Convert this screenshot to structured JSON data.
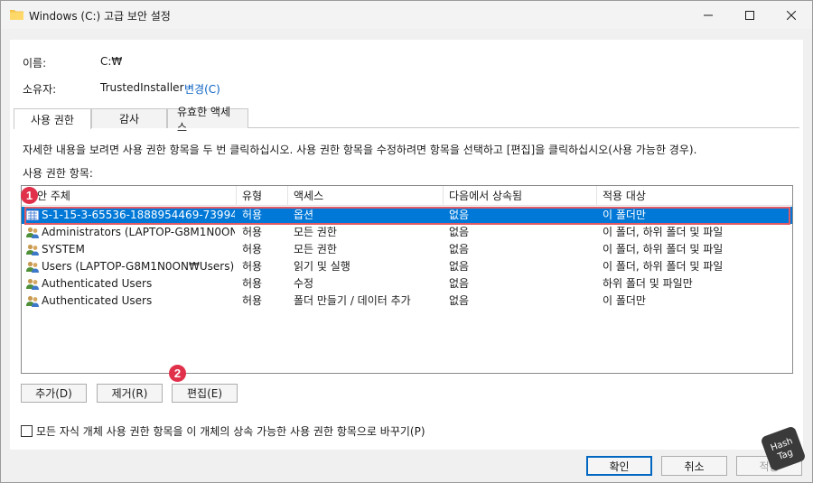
{
  "window": {
    "title": "Windows (C:) 고급 보안 설정"
  },
  "info": {
    "name_label": "이름:",
    "name_value": "C:₩",
    "owner_label": "소유자:",
    "owner_value": "TrustedInstaller",
    "owner_change": "변경(C)"
  },
  "tabs": [
    {
      "label": "사용 권한"
    },
    {
      "label": "감사"
    },
    {
      "label": "유효한 액세스"
    }
  ],
  "description": "자세한 내용을 보려면 사용 권한 항목을 두 번 클릭하십시오. 사용 권한 항목을 수정하려면 항목을 선택하고 [편집]을 클릭하십시오(사용 가능한 경우).",
  "entries_label": "사용 권한 항목:",
  "list": {
    "headers": [
      "보안 주체",
      "유형",
      "액세스",
      "다음에서 상속됨",
      "적용 대상"
    ],
    "rows": [
      {
        "principal": "S-1-15-3-65536-1888954469-73994...",
        "type": "허용",
        "access": "옵션",
        "inherited": "없음",
        "applies": "이 폴더만",
        "selected": true
      },
      {
        "principal": "Administrators (LAPTOP-G8M1N0ON...",
        "type": "허용",
        "access": "모든 권한",
        "inherited": "없음",
        "applies": "이 폴더, 하위 폴더 및 파일"
      },
      {
        "principal": "SYSTEM",
        "type": "허용",
        "access": "모든 권한",
        "inherited": "없음",
        "applies": "이 폴더, 하위 폴더 및 파일"
      },
      {
        "principal": "Users (LAPTOP-G8M1N0ON₩Users)",
        "type": "허용",
        "access": "읽기 및 실행",
        "inherited": "없음",
        "applies": "이 폴더, 하위 폴더 및 파일"
      },
      {
        "principal": "Authenticated Users",
        "type": "허용",
        "access": "수정",
        "inherited": "없음",
        "applies": "하위 폴더 및 파일만"
      },
      {
        "principal": "Authenticated Users",
        "type": "허용",
        "access": "폴더 만들기 / 데이터 추가",
        "inherited": "없음",
        "applies": "이 폴더만"
      }
    ]
  },
  "buttons": {
    "add": "추가(D)",
    "remove": "제거(R)",
    "edit": "편집(E)",
    "ok": "확인",
    "cancel": "취소",
    "apply": "적용"
  },
  "checkbox_label": "모든 자식 개체 사용 권한 항목을 이 개체의 상속 가능한 사용 권한 항목으로 바꾸기(P)",
  "markers": [
    "1",
    "2"
  ],
  "badge_text": [
    "Hash",
    "Tag"
  ],
  "colors": {
    "selection": "#0078d7",
    "highlight_outline": "#e05a66",
    "marker": "#e0304a",
    "link": "#0b61c2"
  }
}
